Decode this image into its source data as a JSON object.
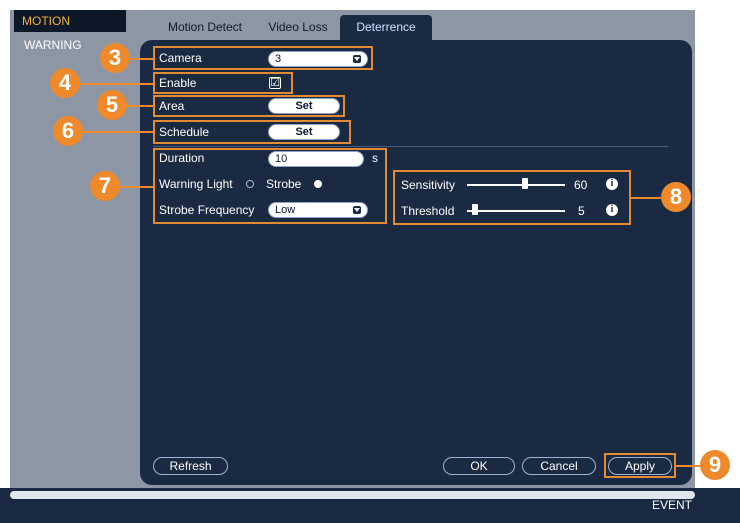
{
  "sidebar": {
    "items": [
      {
        "label": "MOTION",
        "selected": true
      },
      {
        "label": "WARNING",
        "selected": false
      }
    ]
  },
  "tabs": [
    {
      "label": "Motion Detect",
      "active": false
    },
    {
      "label": "Video Loss",
      "active": false
    },
    {
      "label": "Deterrence",
      "active": true
    }
  ],
  "camera": {
    "label": "Camera",
    "value": "3"
  },
  "enable": {
    "label": "Enable",
    "checked": true,
    "mark": "☑"
  },
  "area": {
    "label": "Area",
    "button": "Set"
  },
  "schedule": {
    "label": "Schedule",
    "button": "Set"
  },
  "duration": {
    "label": "Duration",
    "value": "10",
    "unit": "s"
  },
  "warning_light": {
    "label": "Warning Light",
    "option": "Strobe",
    "selected": "Strobe"
  },
  "strobe_frequency": {
    "label": "Strobe Frequency",
    "value": "Low"
  },
  "sensitivity": {
    "label": "Sensitivity",
    "value": "60"
  },
  "threshold": {
    "label": "Threshold",
    "value": "5"
  },
  "info_glyph": "i",
  "buttons": {
    "refresh": "Refresh",
    "ok": "OK",
    "cancel": "Cancel",
    "apply": "Apply"
  },
  "callouts": [
    "3",
    "4",
    "5",
    "6",
    "7",
    "8",
    "9"
  ],
  "footer": {
    "label": "EVENT"
  },
  "colors": {
    "panel": "#1a2a42",
    "accent_orange": "#ee8a2c",
    "sidebar_bg": "#8d96a5",
    "selected_text": "#f0b441"
  }
}
